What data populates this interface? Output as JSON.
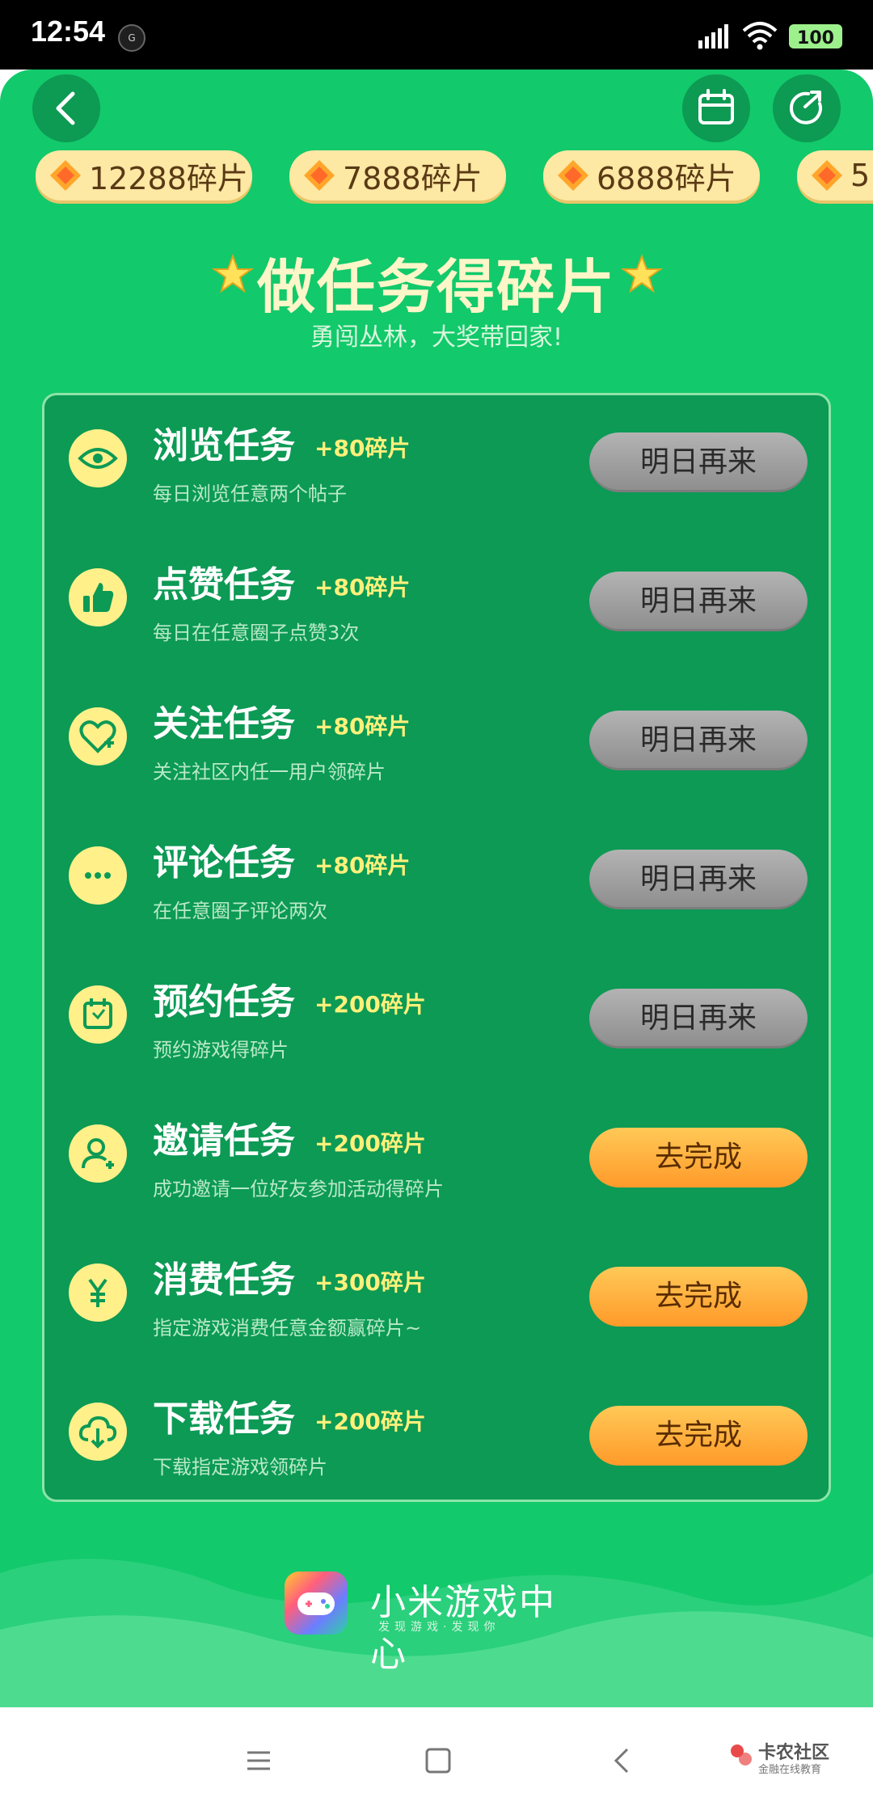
{
  "status_bar": {
    "time": "12:54",
    "small_icon_text": "G",
    "battery": "100"
  },
  "fragment_chips": [
    "12288碎片",
    "7888碎片",
    "6888碎片",
    "5"
  ],
  "header": {
    "title": "做任务得碎片",
    "subtitle": "勇闯丛林，大奖带回家!"
  },
  "tasks": [
    {
      "name": "浏览任务",
      "reward": "+80碎片",
      "desc": "每日浏览任意两个帖子",
      "button": "明日再来",
      "state": "done",
      "icon": "eye-icon"
    },
    {
      "name": "点赞任务",
      "reward": "+80碎片",
      "desc": "每日在任意圈子点赞3次",
      "button": "明日再来",
      "state": "done",
      "icon": "thumbs-up-icon"
    },
    {
      "name": "关注任务",
      "reward": "+80碎片",
      "desc": "关注社区内任一用户领碎片",
      "button": "明日再来",
      "state": "done",
      "icon": "heart-plus-icon"
    },
    {
      "name": "评论任务",
      "reward": "+80碎片",
      "desc": "在任意圈子评论两次",
      "button": "明日再来",
      "state": "done",
      "icon": "comment-dots-icon"
    },
    {
      "name": "预约任务",
      "reward": "+200碎片",
      "desc": "预约游戏得碎片",
      "button": "明日再来",
      "state": "done",
      "icon": "calendar-icon"
    },
    {
      "name": "邀请任务",
      "reward": "+200碎片",
      "desc": "成功邀请一位好友参加活动得碎片",
      "button": "去完成",
      "state": "todo",
      "icon": "user-plus-icon"
    },
    {
      "name": "消费任务",
      "reward": "+300碎片",
      "desc": "指定游戏消费任意金额赢碎片~",
      "button": "去完成",
      "state": "todo",
      "icon": "yen-icon"
    },
    {
      "name": "下载任务",
      "reward": "+200碎片",
      "desc": "下载指定游戏领碎片",
      "button": "去完成",
      "state": "todo",
      "icon": "cloud-download-icon"
    }
  ],
  "brand": {
    "name": "小米游戏中心",
    "tagline": "发现游戏·发现你"
  },
  "watermark": {
    "name": "卡农社区",
    "sub": "金融在线教育"
  },
  "colors": {
    "background": "#12c96b",
    "panel": "#0c9a55",
    "done_button": "#a0a0a0",
    "todo_button": "#ffb240",
    "reward": "#fff07a"
  }
}
